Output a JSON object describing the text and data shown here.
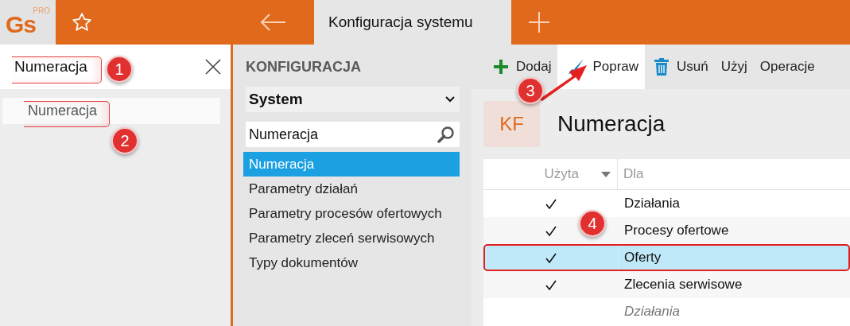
{
  "app": {
    "logo": "Gs",
    "logo_badge": "PRO"
  },
  "tabs": [
    {
      "label": "Konfiguracja systemu",
      "selected": true
    }
  ],
  "quick_search": {
    "value": "Numeracja",
    "results": [
      {
        "label": "Numeracja",
        "selected": true
      }
    ]
  },
  "config_panel": {
    "heading": "KONFIGURACJA",
    "category": "System",
    "filter": "Numeracja",
    "items": [
      {
        "label": "Numeracja",
        "selected": true
      },
      {
        "label": "Parametry działań",
        "selected": false
      },
      {
        "label": "Parametry procesów ofertowych",
        "selected": false
      },
      {
        "label": "Parametry zleceń serwisowych",
        "selected": false
      },
      {
        "label": "Typy dokumentów",
        "selected": false
      }
    ]
  },
  "toolbar": [
    {
      "kind": "add",
      "label": "Dodaj",
      "selected": false
    },
    {
      "kind": "edit",
      "label": "Popraw",
      "selected": true
    },
    {
      "kind": "delete",
      "label": "Usuń",
      "selected": false
    },
    {
      "kind": "plain",
      "label": "Użyj",
      "selected": false
    },
    {
      "kind": "plain",
      "label": "Operacje",
      "selected": false
    }
  ],
  "detail": {
    "badge": "KF",
    "title": "Numeracja",
    "table": {
      "columns": [
        "Użyta",
        "Dla"
      ],
      "rows": [
        {
          "used": true,
          "for": "Działania",
          "selected": false,
          "italic": false,
          "outlined": false
        },
        {
          "used": true,
          "for": "Procesy ofertowe",
          "selected": false,
          "italic": false,
          "outlined": false
        },
        {
          "used": true,
          "for": "Oferty",
          "selected": true,
          "italic": false,
          "outlined": true
        },
        {
          "used": true,
          "for": "Zlecenia serwisowe",
          "selected": false,
          "italic": false,
          "outlined": false
        },
        {
          "used": false,
          "for": "Działania",
          "selected": false,
          "italic": true,
          "outlined": false
        }
      ]
    }
  },
  "annotations": [
    {
      "label": "1"
    },
    {
      "label": "2"
    },
    {
      "label": "3"
    },
    {
      "label": "4"
    }
  ]
}
